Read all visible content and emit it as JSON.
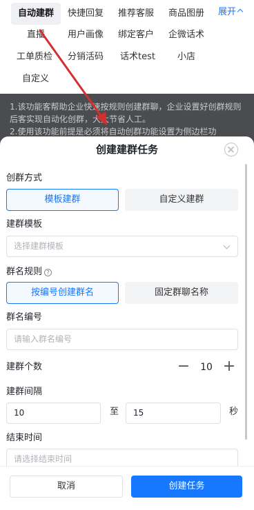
{
  "nav": {
    "items": [
      "自动建群",
      "快捷回复",
      "推荐客服",
      "商品图册",
      "直播",
      "用户画像",
      "绑定客户",
      "企微话术",
      "工单质检",
      "分销活码",
      "话术test",
      "小店",
      "自定义"
    ],
    "expand_label": "展开"
  },
  "tip": {
    "line1": "1.该功能客帮助企业快速按规则创建群聊，企业设置好创群规则后客实现自动化创群，大大节省人工。",
    "line2": "2.使用该功能前提是必须将自动创群功能设置为侧边栏功"
  },
  "sheet": {
    "title": "创建建群任务",
    "method_label": "创群方式",
    "method_options": [
      "模板建群",
      "自定义建群"
    ],
    "template_label": "建群模板",
    "template_placeholder": "选择建群模板",
    "naming_label": "群名规则",
    "naming_help": "?",
    "naming_options": [
      "按编号创建群名",
      "固定群聊名称"
    ],
    "number_label": "群名编号",
    "number_placeholder": "请输入群名编号",
    "count_label": "建群个数",
    "count_value": "10",
    "count_minus": "−",
    "count_plus": "+",
    "interval_label": "建群间隔",
    "interval_from": "10",
    "interval_to_word": "至",
    "interval_to": "15",
    "interval_unit": "秒",
    "end_label": "结束时间",
    "end_placeholder": "请选择结束时间"
  },
  "footer": {
    "cancel": "取消",
    "submit": "创建任务"
  },
  "colors": {
    "accent": "#1677ff",
    "annotation_arrow": "#d32f2f"
  }
}
